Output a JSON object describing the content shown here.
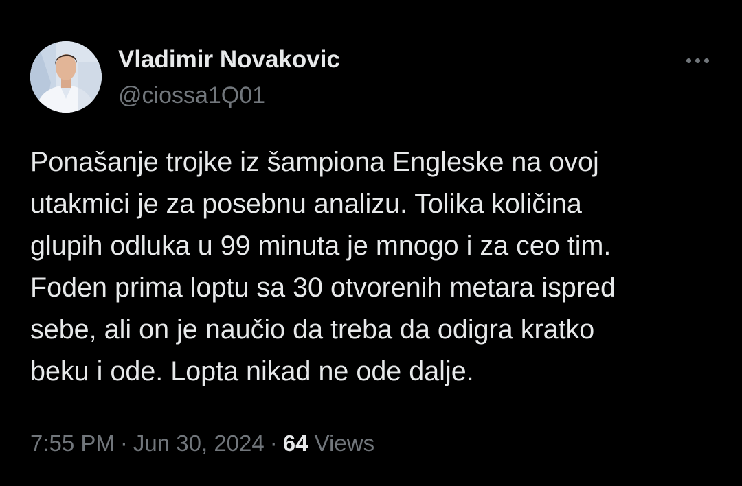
{
  "author": {
    "name": "Vladimir Novakovic",
    "handle": "@ciossa1Ϙ01"
  },
  "tweet": {
    "lines": [
      "Ponašanje trojke iz šampiona Engleske na ovoj",
      "utakmici je za posebnu analizu. Tolika količina",
      "glupih odluka u 99 minuta je mnogo i za ceo tim.",
      "Foden prima loptu sa 30 otvorenih metara ispred",
      "sebe, ali on je naučio da treba da odigra kratko",
      "beku i ode. Lopta nikad ne ode dalje."
    ]
  },
  "meta": {
    "time": "7:55 PM",
    "separator": "·",
    "date": "Jun 30, 2024",
    "views_count": "64",
    "views_label": "Views"
  },
  "icons": {
    "more": "more-horizontal-icon",
    "avatar": "profile-photo"
  },
  "colors": {
    "background": "#000000",
    "primary_text": "#e7e9ea",
    "secondary_text": "#71767b"
  }
}
